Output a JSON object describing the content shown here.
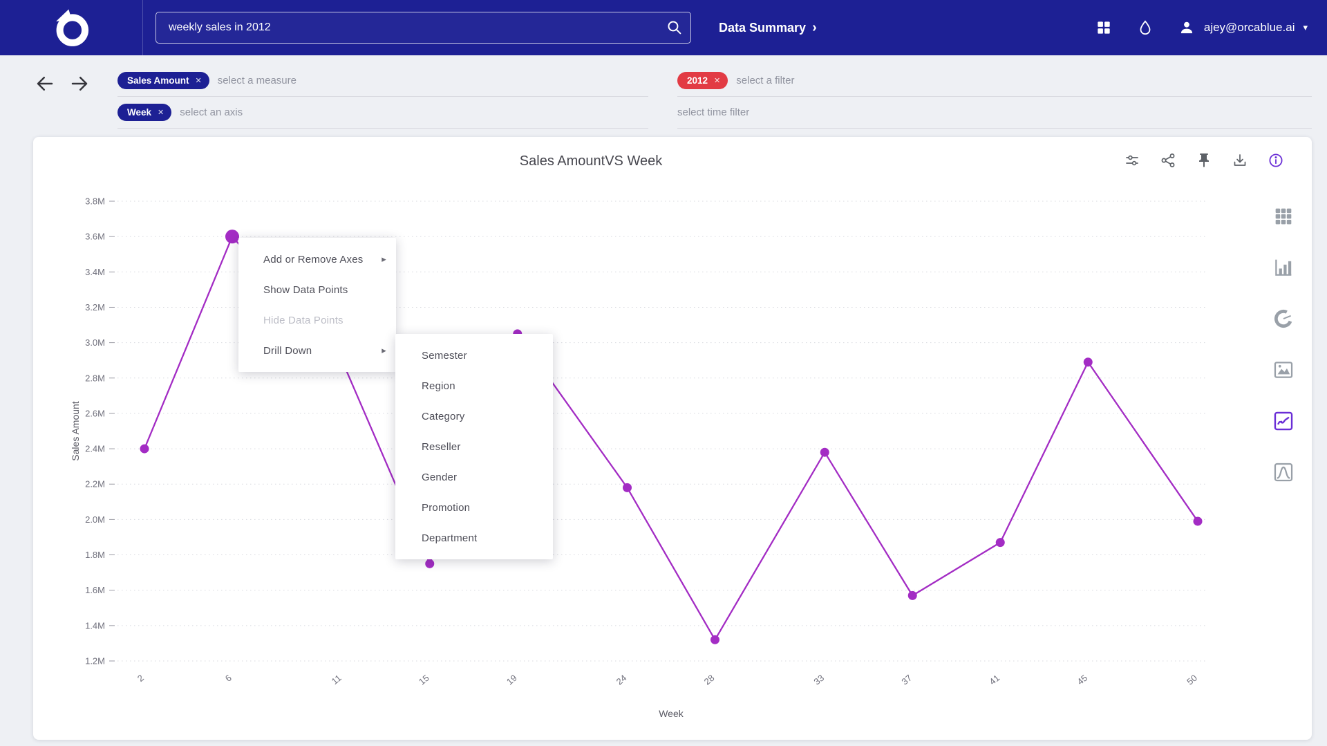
{
  "navbar": {
    "search": {
      "value": "weekly sales in 2012"
    },
    "section_label": "Data Summary",
    "user_email": "ajey@orcablue.ai"
  },
  "glyphs": {
    "chevron_right": "›",
    "chevron_down": "▾",
    "close": "✕",
    "submenu_arrow": "▸"
  },
  "filters": {
    "measure": {
      "chip": "Sales Amount",
      "placeholder": "select a measure"
    },
    "axis": {
      "chip": "Week",
      "placeholder": "select an axis"
    },
    "year_filter": {
      "chip": "2012",
      "placeholder": "select a filter"
    },
    "time_filter": {
      "placeholder": "select time filter"
    }
  },
  "context_menu": {
    "items": [
      {
        "label": "Add or Remove Axes",
        "submenu": true,
        "disabled": false
      },
      {
        "label": "Show Data Points",
        "submenu": false,
        "disabled": false
      },
      {
        "label": "Hide Data Points",
        "submenu": false,
        "disabled": true
      },
      {
        "label": "Drill Down",
        "submenu": true,
        "disabled": false
      }
    ]
  },
  "drill_down_submenu": {
    "items": [
      "Semester",
      "Region",
      "Category",
      "Reseller",
      "Gender",
      "Promotion",
      "Department"
    ]
  },
  "card_actions": {
    "icons": [
      "settings-sliders",
      "share",
      "pin",
      "export",
      "info"
    ]
  },
  "chart_type_toolbar": {
    "icons": [
      "table",
      "bar-chart",
      "donut-chart",
      "area-chart",
      "line-chart",
      "distribution-curve"
    ],
    "selected": "line-chart"
  },
  "chart_data": {
    "type": "line",
    "title": "Sales AmountVS Week",
    "xlabel": "Week",
    "ylabel": "Sales Amount",
    "x": [
      2,
      6,
      11,
      15,
      19,
      24,
      28,
      33,
      37,
      41,
      45,
      50
    ],
    "xtick_labels": [
      "2",
      "6",
      "11",
      "15",
      "19",
      "24",
      "28",
      "33",
      "37",
      "41",
      "45",
      "50"
    ],
    "series": [
      {
        "name": "Sales Amount",
        "values_millions": [
          2.4,
          3.6,
          2.9,
          1.75,
          3.05,
          2.18,
          1.32,
          2.38,
          1.57,
          1.87,
          2.89,
          1.99
        ]
      }
    ],
    "ylim_millions": [
      1.2,
      3.8
    ],
    "ytick_labels": [
      "3.8M",
      "3.6M",
      "3.4M",
      "3.2M",
      "3.0M",
      "2.8M",
      "2.6M",
      "2.4M",
      "2.2M",
      "2.0M",
      "1.8M",
      "1.6M",
      "1.4M",
      "1.2M"
    ],
    "grid": "horizontal-dotted",
    "legend": "none",
    "line_color": "#a32cc4",
    "selected_point": {
      "x": 6,
      "value_millions": 3.6
    }
  }
}
